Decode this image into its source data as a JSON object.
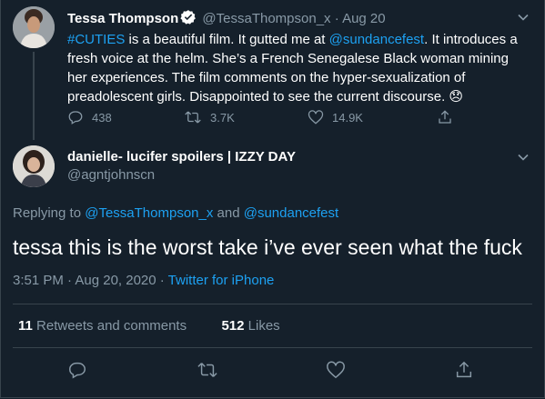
{
  "tweet1": {
    "name": "Tessa Thompson",
    "handle": "@TessaThompson_x",
    "separator": "·",
    "date": "Aug 20",
    "hashtag": "#CUTIES",
    "text_a": " is a beautiful film. It gutted me at ",
    "mention": "@sundancefest",
    "text_b": ".  It introduces a fresh voice at the helm. She’s a French Senegalese Black woman mining her experiences. The film comments on the hyper-sexualization of preadolescent girls. Disappointed to see the current discourse. ",
    "emoji": "😞",
    "replies": "438",
    "retweets": "3.7K",
    "likes": "14.9K"
  },
  "tweet2": {
    "name": "danielle- lucifer spoilers | IZZY DAY",
    "handle": "@agntjohnscn",
    "replying_prefix": "Replying to ",
    "replying_user1": "@TessaThompson_x",
    "replying_and": " and ",
    "replying_user2": "@sundancefest",
    "text": "tessa this is the worst take i’ve ever seen what the fuck",
    "time": "3:51 PM · Aug 20, 2020 · ",
    "source": "Twitter for iPhone",
    "retweets_count": "11",
    "retweets_label": " Retweets and comments",
    "likes_count": "512",
    "likes_label": " Likes"
  },
  "colors": {
    "background": "#15202b",
    "link": "#1da1f2",
    "muted": "#8899a6",
    "divider": "#38444d"
  },
  "icons": [
    "verified-badge-icon",
    "chevron-down-icon",
    "reply-icon",
    "retweet-icon",
    "like-icon",
    "share-icon"
  ]
}
